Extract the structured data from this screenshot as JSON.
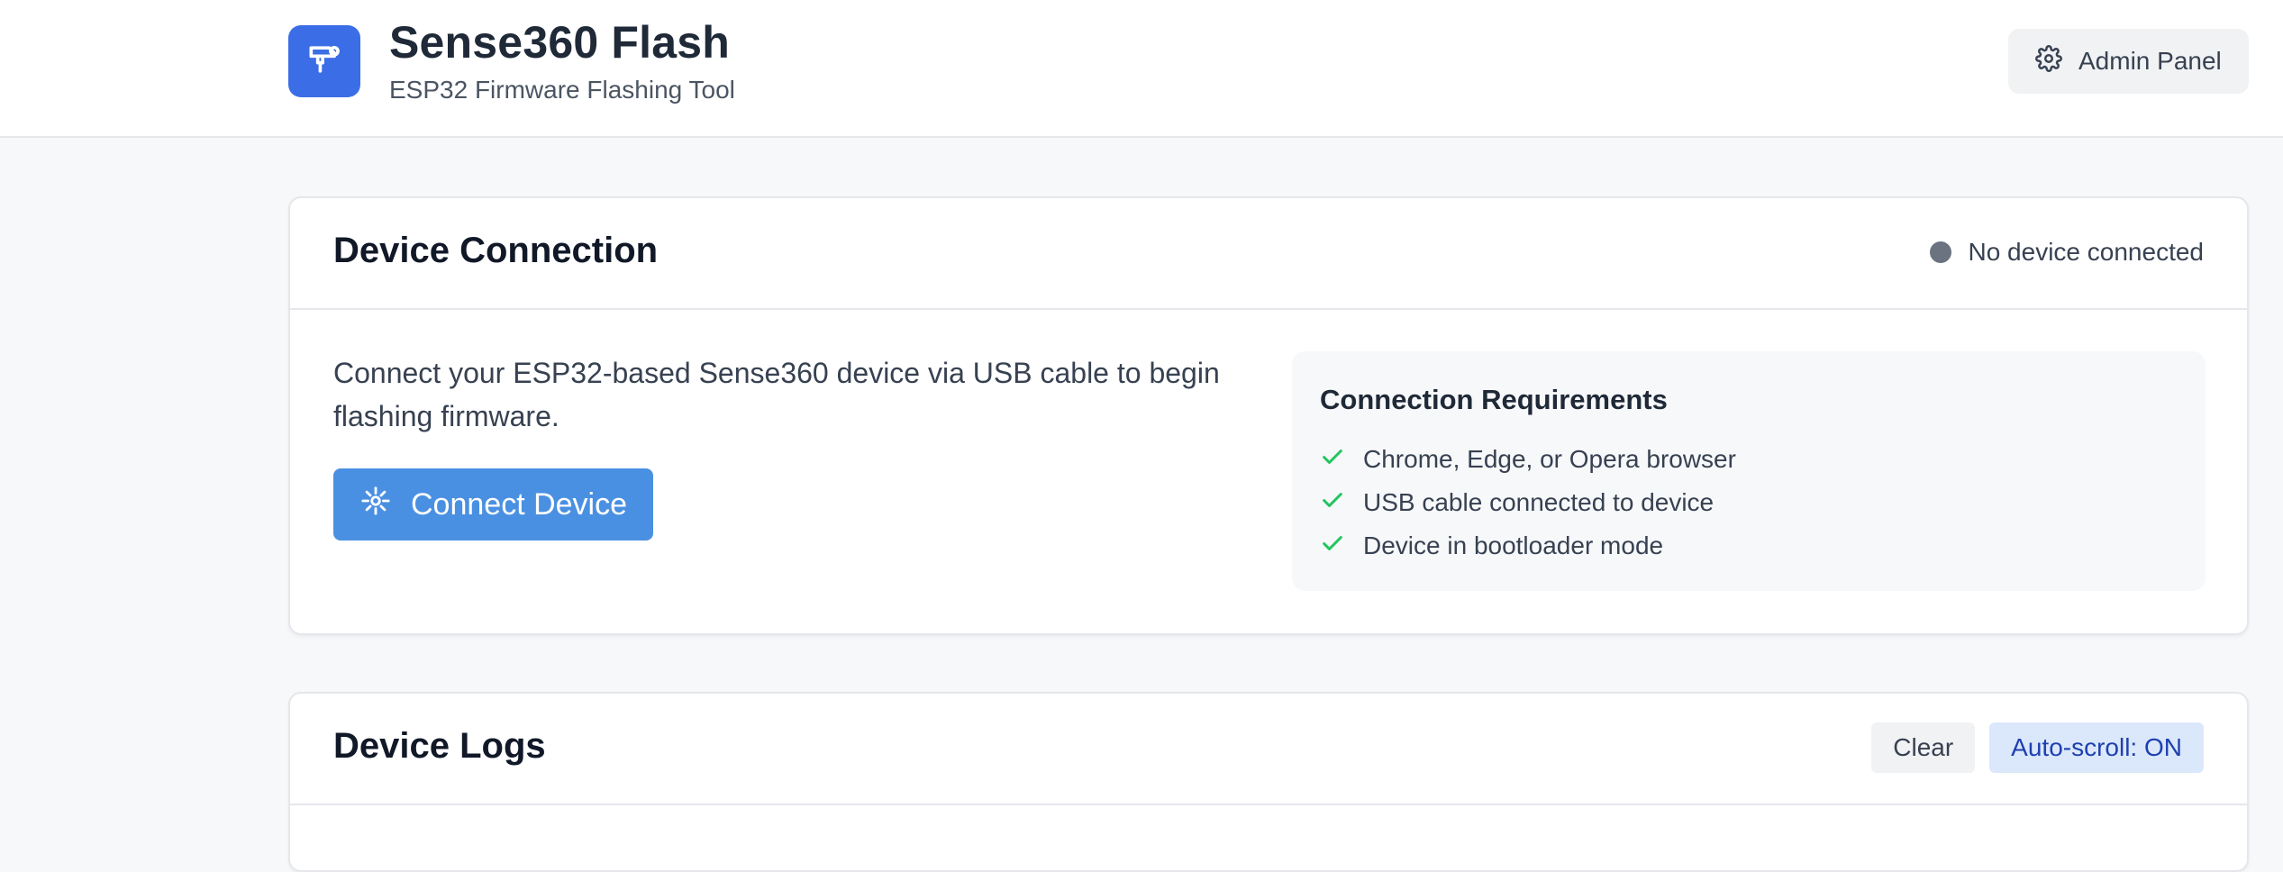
{
  "header": {
    "title": "Sense360 Flash",
    "subtitle": "ESP32 Firmware Flashing Tool",
    "admin_button": "Admin Panel",
    "logo_icon": "flash-drill-icon",
    "brand_color": "#3b6ee6"
  },
  "connection": {
    "title": "Device Connection",
    "status": "No device connected",
    "status_color": "#6b7280",
    "intro": "Connect your ESP32-based Sense360 device via USB cable to begin flashing firmware.",
    "connect_button": "Connect Device",
    "connect_color": "#4a90e2",
    "requirements": {
      "title": "Connection Requirements",
      "items": [
        {
          "label": "Chrome, Edge, or Opera browser",
          "icon": "check-icon"
        },
        {
          "label": "USB cable connected to device",
          "icon": "check-icon"
        },
        {
          "label": "Device in bootloader mode",
          "icon": "check-icon"
        }
      ],
      "check_color": "#22c55e"
    }
  },
  "logs": {
    "title": "Device Logs",
    "clear_button": "Clear",
    "autoscroll_button": "Auto-scroll: ON"
  }
}
